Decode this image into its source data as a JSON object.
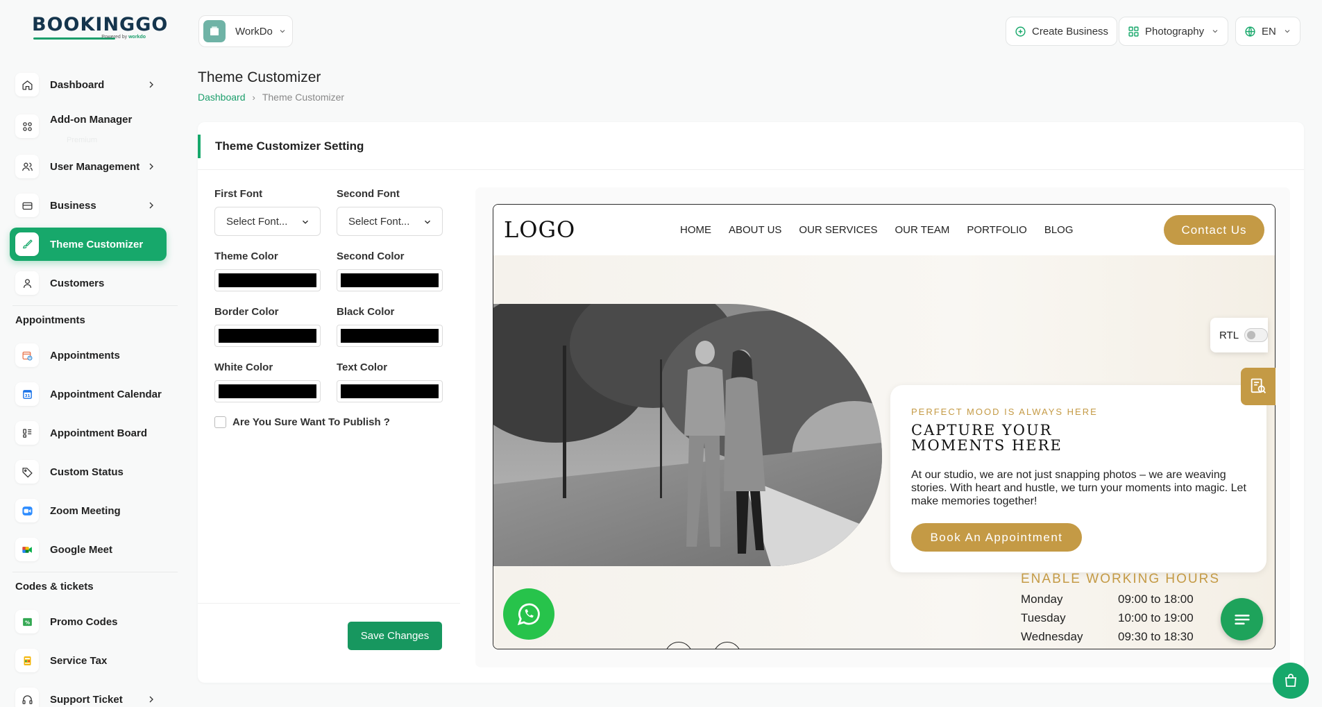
{
  "brand": {
    "name": "BOOKINGGO",
    "powered_prefix": "Powered by",
    "powered_by": "workdo"
  },
  "sidebar": {
    "items": [
      {
        "label": "Dashboard"
      },
      {
        "label": "Add-on Manager",
        "ghost": "Premium"
      },
      {
        "label": "User Management"
      },
      {
        "label": "Business"
      },
      {
        "label": "Theme Customizer"
      },
      {
        "label": "Customers"
      }
    ],
    "appointments_title": "Appointments",
    "appointments": [
      {
        "label": "Appointments"
      },
      {
        "label": "Appointment Calendar"
      },
      {
        "label": "Appointment Board"
      },
      {
        "label": "Custom Status"
      },
      {
        "label": "Zoom Meeting"
      },
      {
        "label": "Google Meet"
      }
    ],
    "codes_title": "Codes & tickets",
    "codes": [
      {
        "label": "Promo Codes"
      },
      {
        "label": "Service Tax"
      },
      {
        "label": "Support Ticket"
      }
    ]
  },
  "topbar": {
    "workspace": "WorkDo",
    "create_business": "Create Business",
    "category": "Photography",
    "language": "EN"
  },
  "page": {
    "title": "Theme Customizer",
    "breadcrumb": [
      "Dashboard",
      "Theme Customizer"
    ]
  },
  "form": {
    "card_title": "Theme Customizer Setting",
    "first_font_label": "First Font",
    "first_font_value": "Select Font...",
    "second_font_label": "Second Font",
    "second_font_value": "Select Font...",
    "theme_color_label": "Theme Color",
    "second_color_label": "Second Color",
    "border_color_label": "Border Color",
    "black_color_label": "Black Color",
    "white_color_label": "White Color",
    "text_color_label": "Text Color",
    "publish_label": "Are You Sure Want To Publish ?",
    "save_label": "Save Changes",
    "color_values": {
      "theme": "#000000",
      "second": "#000000",
      "border": "#000000",
      "black": "#000000",
      "white": "#000000",
      "text": "#000000"
    }
  },
  "preview": {
    "logo": "LOGO",
    "nav": [
      "HOME",
      "ABOUT US",
      "OUR SERVICES",
      "OUR TEAM",
      "PORTFOLIO",
      "BLOG"
    ],
    "contact_label": "Contact Us",
    "eyebrow": "PERFECT MOOD IS ALWAYS HERE",
    "headline": "CAPTURE YOUR MOMENTS HERE",
    "description": "At our studio, we are not just snapping photos – we are weaving stories. With heart and hustle, we turn your moments into magic. Let make memories together!",
    "book_label": "Book An Appointment",
    "hours_title": "ENABLE WORKING HOURS",
    "hours": [
      {
        "day": "Monday",
        "time": "09:00 to 18:00"
      },
      {
        "day": "Tuesday",
        "time": "10:00 to 19:00"
      },
      {
        "day": "Wednesday",
        "time": "09:30 to 18:30"
      }
    ],
    "accent_color": "#c49a45"
  },
  "rtl": {
    "label": "RTL"
  },
  "colors": {
    "primary": "#17a86b",
    "gold": "#c49a45",
    "whatsapp": "#27c34b"
  }
}
